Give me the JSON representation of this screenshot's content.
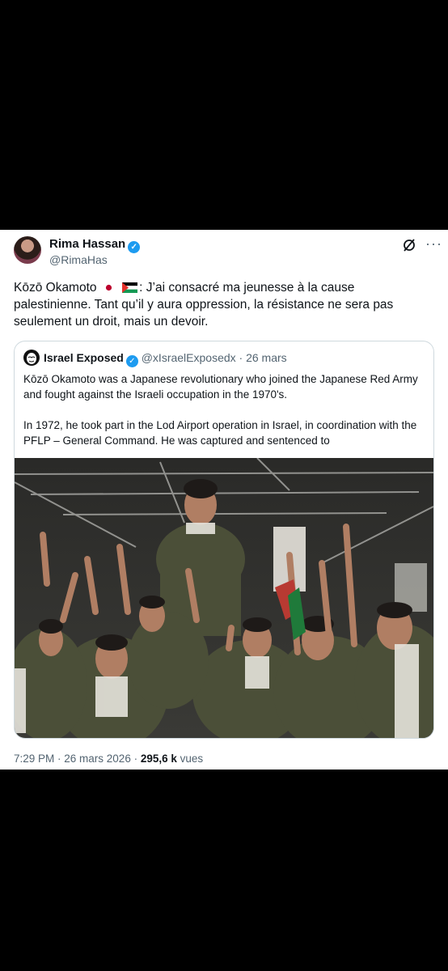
{
  "post": {
    "author_name": "Rima Hassan",
    "author_handle": "@RimaHas",
    "text_name": "Kōzō Okamoto",
    "text_body": ": J’ai consacré ma jeunesse à la cause palestinienne. Tant qu’il y aura oppression, la résistance ne sera pas seulement un droit, mais un devoir."
  },
  "quote": {
    "author_name": "Israel Exposed",
    "author_handle": "@xIsraelExposedx",
    "date": "· 26 mars",
    "paragraph1": "Kōzō Okamoto was a Japanese revolutionary who joined the Japanese Red Army and fought against the Israeli occupation in the 1970's.",
    "paragraph2": "In 1972, he took part in the Lod Airport operation in Israel, in coordination with the PFLP – General Command. He was captured and sentenced to"
  },
  "footer": {
    "time": "7:29 PM · 26 mars 2026 ·",
    "views": "295,6 k",
    "views_label": "vues"
  },
  "icons": {
    "verified": "verified-badge-icon",
    "grok": "grok-icon",
    "more": "more-icon",
    "flag_japan": "japan-flag-icon",
    "flag_palestine": "palestine-flag-icon"
  },
  "colors": {
    "verified_blue": "#1d9bf0",
    "secondary_text": "#536471",
    "border": "#cfd9de"
  }
}
